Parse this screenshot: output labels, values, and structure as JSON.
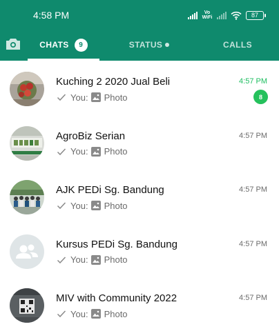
{
  "status_bar": {
    "time": "4:58 PM",
    "network": "Vo WiFi",
    "battery": "87"
  },
  "tabs": [
    {
      "label": "CHATS",
      "badge": "9",
      "active": true
    },
    {
      "label": "STATUS",
      "has_dot": true
    },
    {
      "label": "CALLS"
    }
  ],
  "chats": [
    {
      "name": "Kuching 2 2020 Jual Beli",
      "time": "4:57 PM",
      "sender": "You:",
      "message": "Photo",
      "unread": "8",
      "avatar": "photo-red-flowers"
    },
    {
      "name": "AgroBiz Serian",
      "time": "4:57 PM",
      "sender": "You:",
      "message": "Photo",
      "avatar": "agrobiz-logo"
    },
    {
      "name": "AJK PEDi Sg. Bandung",
      "time": "4:57 PM",
      "sender": "You:",
      "message": "Photo",
      "avatar": "group-photo"
    },
    {
      "name": "Kursus PEDi Sg. Bandung",
      "time": "4:57 PM",
      "sender": "You:",
      "message": "Photo",
      "avatar": "default-group"
    },
    {
      "name": "MIV with Community 2022",
      "time": "4:57 PM",
      "sender": "You:",
      "message": "Photo",
      "avatar": "qr-code"
    }
  ],
  "colors": {
    "header": "#0f8a6d",
    "unread": "#25c15c",
    "text_secondary": "#6b6b6b"
  }
}
